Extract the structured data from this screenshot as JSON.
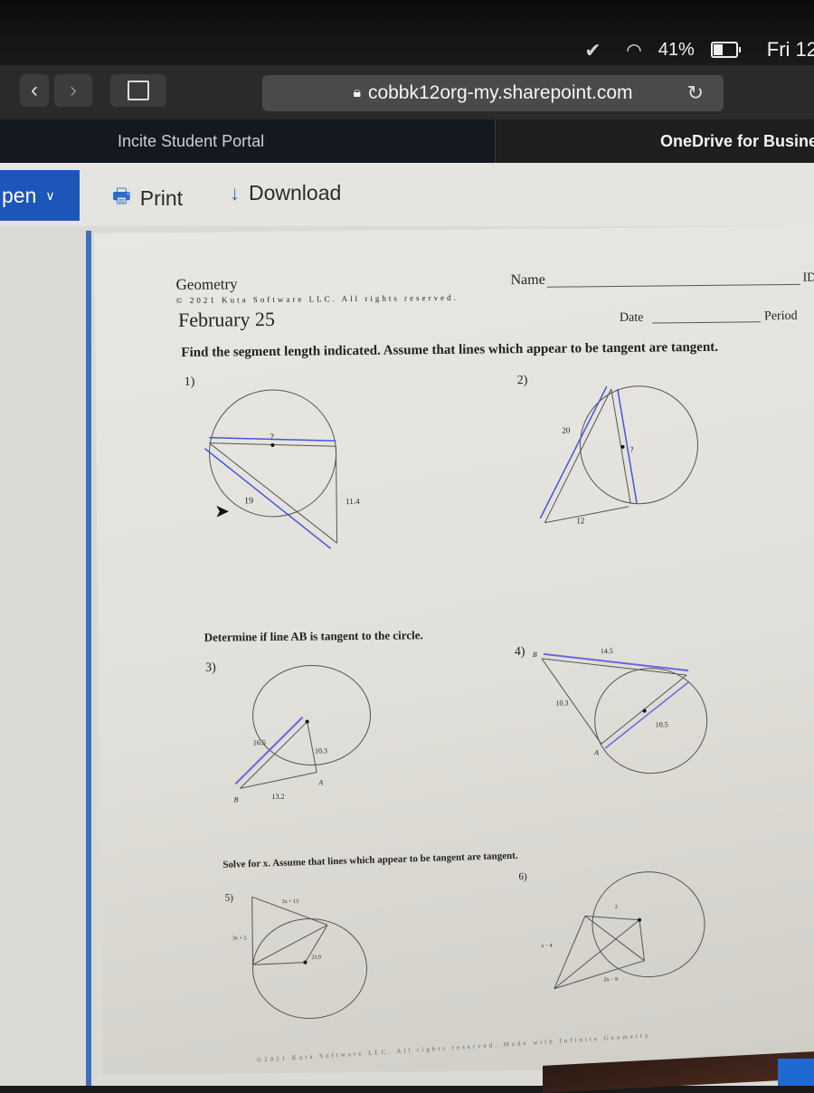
{
  "menubar": {
    "status_icons": [
      "check-badge-icon",
      "wifi-icon",
      "battery-icon"
    ],
    "battery_percent": "41%",
    "battery_level": 0.41,
    "clock": "Fri 12"
  },
  "browser": {
    "url": "cobbk12org-my.sharepoint.com",
    "tabs": [
      {
        "label": "Incite Student Portal"
      },
      {
        "label": "OneDrive for Busine"
      }
    ]
  },
  "commandbar": {
    "open_label": "pen",
    "print_label": "Print",
    "download_label": "Download"
  },
  "worksheet": {
    "subject": "Geometry",
    "copyright": "© 2021 Kuta Software LLC. All rights reserved.",
    "title": "February 25",
    "name_label": "Name",
    "id_label": "ID",
    "date_label": "Date",
    "period_label": "Period",
    "instructions_1": "Find the segment length indicated.  Assume that lines which appear to be tangent are tangent.",
    "instructions_2": "Determine if line AB is tangent to the circle.",
    "instructions_3": "Solve for x.  Assume that lines which appear to be tangent are tangent.",
    "problems": [
      {
        "number": "1)",
        "labels": [
          "?",
          "19",
          "11.4"
        ]
      },
      {
        "number": "2)",
        "labels": [
          "20",
          "?",
          "12"
        ]
      },
      {
        "number": "3)",
        "labels": [
          "16.5",
          "10.3",
          "13.2",
          "A",
          "B"
        ]
      },
      {
        "number": "4)",
        "labels": [
          "14.5",
          "10.3",
          "10.5",
          "A",
          "B"
        ]
      },
      {
        "number": "5)",
        "labels": [
          "2x + 13",
          "3x + 5",
          "23.9"
        ]
      },
      {
        "number": "6)",
        "labels": [
          "2",
          "x − 4",
          "2x − 9"
        ]
      }
    ],
    "footer": "©2021 Kuta Software LLC.  All rights reserved.  Made with Infinite Geometry."
  }
}
